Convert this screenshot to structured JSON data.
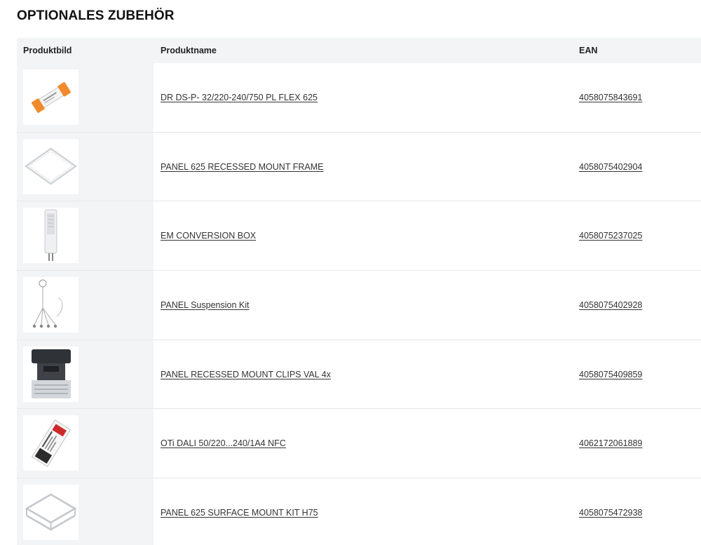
{
  "page": {
    "title": "OPTIONALES ZUBEHÖR"
  },
  "table": {
    "headers": {
      "image": "Produktbild",
      "name": "Produktname",
      "ean": "EAN"
    },
    "rows": [
      {
        "name": "DR DS-P- 32/220-240/750 PL FLEX 625",
        "ean": "4058075843691",
        "image": "driver-image"
      },
      {
        "name": "PANEL 625 RECESSED MOUNT FRAME",
        "ean": "4058075402904",
        "image": "frame-image"
      },
      {
        "name": "EM CONVERSION BOX",
        "ean": "4058075237025",
        "image": "box-image"
      },
      {
        "name": "PANEL Suspension Kit",
        "ean": "4058075402928",
        "image": "suspension-kit-image"
      },
      {
        "name": "PANEL RECESSED MOUNT CLIPS VAL 4x",
        "ean": "4058075409859",
        "image": "clip-image"
      },
      {
        "name": "OTi DALI 50/220...240/1A4 NFC",
        "ean": "4062172061889",
        "image": "dali-driver-image"
      },
      {
        "name": "PANEL 625 SURFACE MOUNT KIT H75",
        "ean": "4058075472938",
        "image": "surface-frame-image"
      }
    ]
  }
}
